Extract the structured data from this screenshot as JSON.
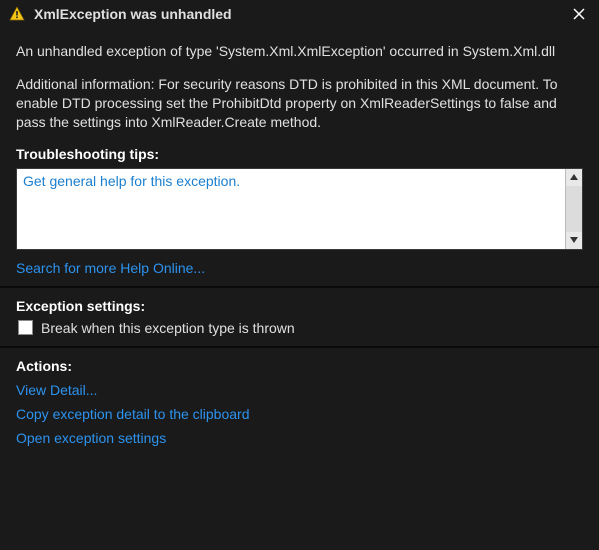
{
  "titlebar": {
    "title": "XmlException was unhandled"
  },
  "messages": {
    "summary": "An unhandled exception of type 'System.Xml.XmlException' occurred in System.Xml.dll",
    "additional": "Additional information: For security reasons DTD is prohibited in this XML document. To enable DTD processing set the ProhibitDtd property on XmlReaderSettings to false and pass the settings into XmlReader.Create method."
  },
  "sections": {
    "troubleshooting_heading": "Troubleshooting tips:",
    "exception_settings_heading": "Exception settings:",
    "actions_heading": "Actions:"
  },
  "tips": {
    "general_help": "Get general help for this exception."
  },
  "links": {
    "search_help_online": "Search for more Help Online...",
    "view_detail": "View Detail...",
    "copy_to_clipboard": "Copy exception detail to the clipboard",
    "open_settings": "Open exception settings"
  },
  "settings": {
    "break_on_thrown_label": "Break when this exception type is thrown"
  }
}
